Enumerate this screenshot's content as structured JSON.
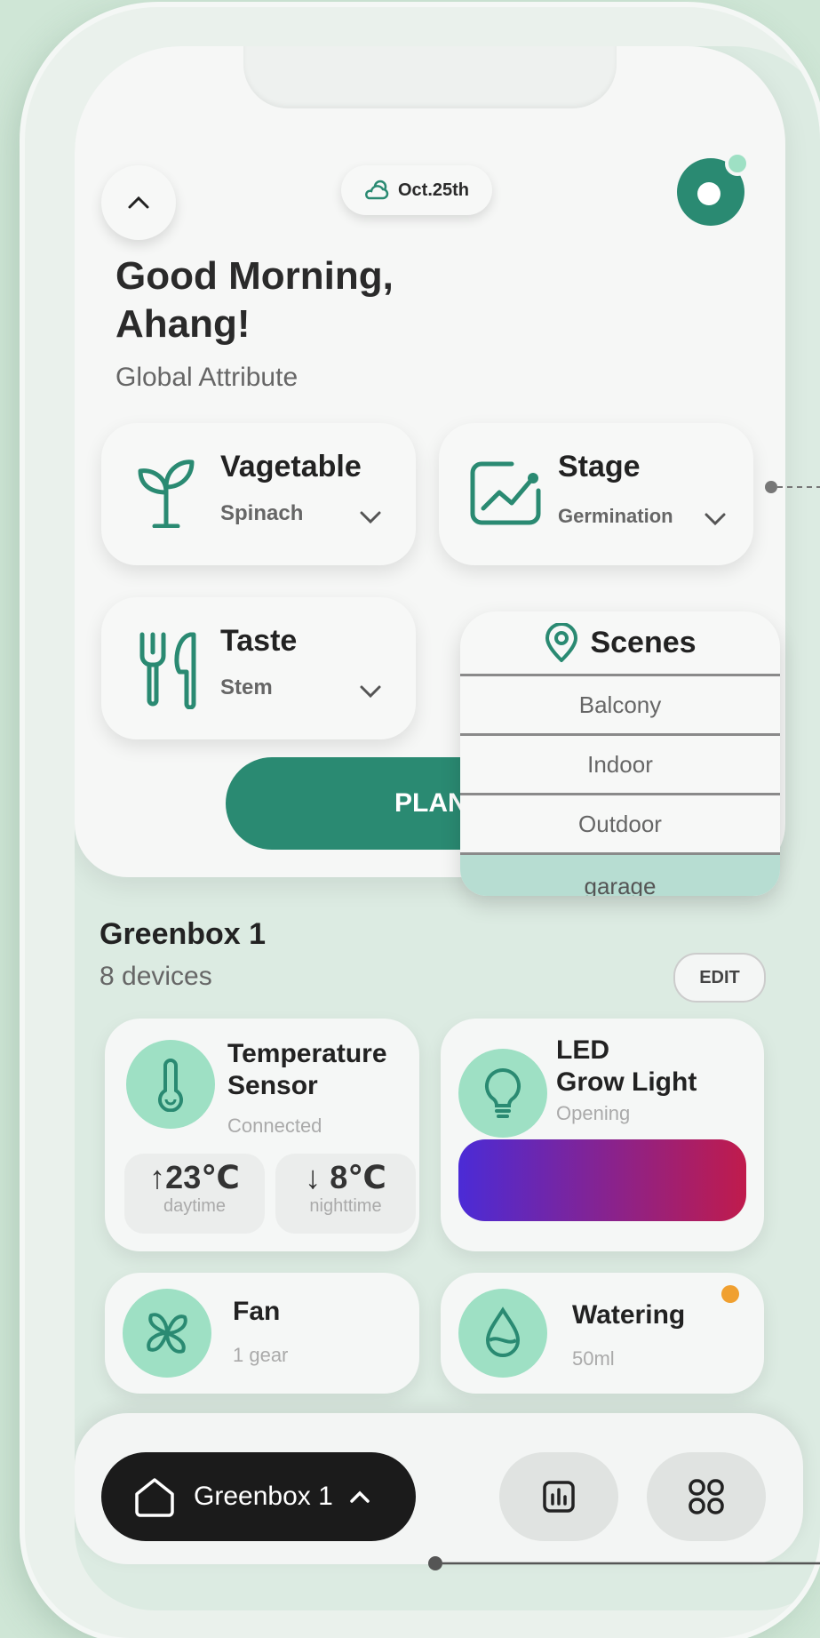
{
  "header": {
    "date": "Oct.25th",
    "greeting_line1": "Good Morning,",
    "greeting_line2": "Ahang!",
    "subtitle": "Global Attribute"
  },
  "attributes": {
    "vegetable": {
      "title": "Vagetable",
      "value": "Spinach"
    },
    "stage": {
      "title": "Stage",
      "value": "Germination"
    },
    "taste": {
      "title": "Taste",
      "value": "Stem"
    },
    "scenes": {
      "title": "Scenes",
      "options": [
        "Balcony",
        "Indoor",
        "Outdoor",
        "garage"
      ],
      "selected": "garage"
    }
  },
  "plant_button": {
    "label": "PLAN"
  },
  "greenbox": {
    "title": "Greenbox 1",
    "subtitle": "8 devices",
    "edit_label": "EDIT"
  },
  "devices": {
    "temperature": {
      "name_line1": "Temperature",
      "name_line2": "Sensor",
      "status": "Connected",
      "day_value": "↑23℃",
      "day_label": "daytime",
      "night_value": "↓ 8℃",
      "night_label": "nighttime"
    },
    "led": {
      "name_line1": "LED",
      "name_line2": "Grow Light",
      "status": "Opening"
    },
    "fan": {
      "name": "Fan",
      "status": "1 gear"
    },
    "watering": {
      "name": "Watering",
      "status": "50ml"
    }
  },
  "bottom_nav": {
    "home_label": "Greenbox 1"
  },
  "icons": {
    "back": "chevron-up-icon",
    "weather": "cloud-sun-icon",
    "logo": "app-logo",
    "vegetable": "sprout-icon",
    "stage": "chart-up-icon",
    "taste": "utensils-icon",
    "scenes": "location-pin-icon",
    "temperature": "thermometer-icon",
    "led": "bulb-icon",
    "fan": "fan-icon",
    "watering": "water-drop-icon",
    "home": "home-icon",
    "stats": "bar-chart-icon",
    "grid": "grid-icon"
  },
  "colors": {
    "accent": "#2a8a72",
    "mint": "#9ee0c4",
    "background": "#cfe6d6",
    "alert_dot": "#f0a030"
  }
}
